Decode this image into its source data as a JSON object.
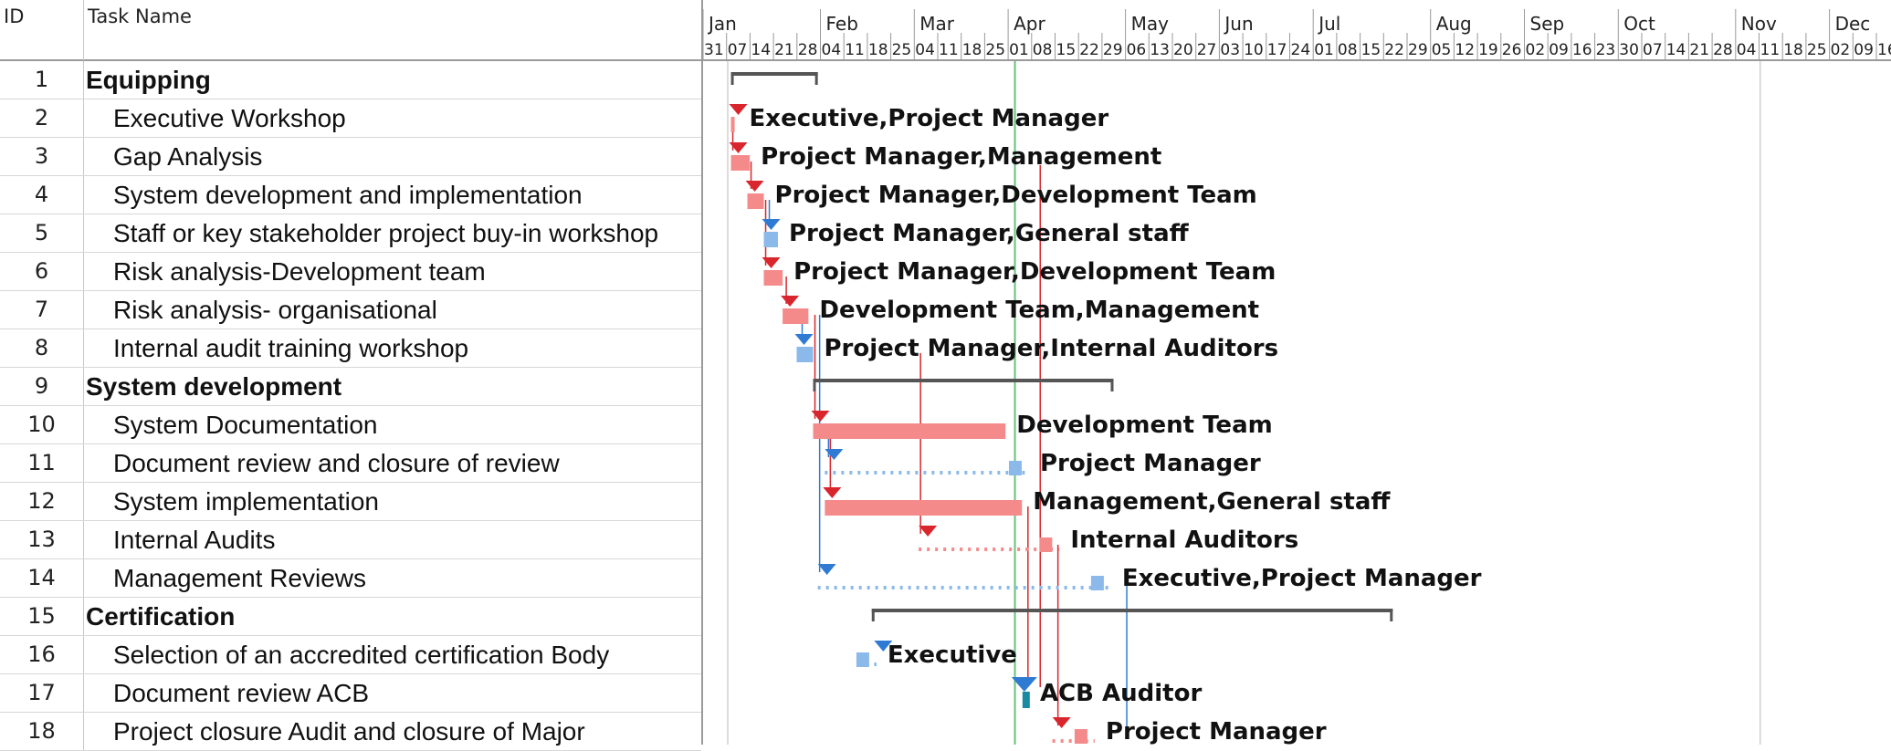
{
  "grid": {
    "col_id": "ID",
    "col_name": "Task Name",
    "rows": [
      {
        "id": "1",
        "name": "Equipping",
        "summary": true
      },
      {
        "id": "2",
        "name": "Executive Workshop",
        "summary": false
      },
      {
        "id": "3",
        "name": "Gap Analysis",
        "summary": false
      },
      {
        "id": "4",
        "name": "System development and implementation",
        "summary": false
      },
      {
        "id": "5",
        "name": "Staff or key stakeholder project buy-in workshop",
        "summary": false
      },
      {
        "id": "6",
        "name": "Risk analysis-Development team",
        "summary": false
      },
      {
        "id": "7",
        "name": "Risk analysis- organisational",
        "summary": false
      },
      {
        "id": "8",
        "name": "Internal audit training workshop",
        "summary": false
      },
      {
        "id": "9",
        "name": "System development",
        "summary": true
      },
      {
        "id": "10",
        "name": "System Documentation",
        "summary": false
      },
      {
        "id": "11",
        "name": "Document review and closure of review",
        "summary": false
      },
      {
        "id": "12",
        "name": "System implementation",
        "summary": false
      },
      {
        "id": "13",
        "name": "Internal Audits",
        "summary": false
      },
      {
        "id": "14",
        "name": "Management Reviews",
        "summary": false
      },
      {
        "id": "15",
        "name": "Certification",
        "summary": true
      },
      {
        "id": "16",
        "name": "Selection of an accredited certification Body",
        "summary": false
      },
      {
        "id": "17",
        "name": "Document review ACB",
        "summary": false
      },
      {
        "id": "18",
        "name": "Project closure Audit and closure of Major",
        "summary": false
      }
    ]
  },
  "timeline": {
    "months": [
      "Jan",
      "Feb",
      "Mar",
      "Apr",
      "May",
      "Jun",
      "Jul",
      "Aug",
      "Sep",
      "Oct",
      "Nov",
      "Dec"
    ],
    "weeks": [
      "31",
      "07",
      "14",
      "21",
      "28",
      "04",
      "11",
      "18",
      "25",
      "04",
      "11",
      "18",
      "25",
      "01",
      "08",
      "15",
      "22",
      "29",
      "06",
      "13",
      "20",
      "27",
      "03",
      "10",
      "17",
      "24",
      "01",
      "08",
      "15",
      "22",
      "29",
      "05",
      "12",
      "19",
      "26",
      "02",
      "09",
      "16",
      "23",
      "30",
      "07",
      "14",
      "21",
      "28",
      "04",
      "11",
      "18",
      "25",
      "02",
      "09",
      "16"
    ]
  },
  "gantt": {
    "today_week": 12.9,
    "colors": {
      "critical": "#f58a8a",
      "critical_dark": "#d9262c",
      "normal": "#8ab9ea",
      "normal_dark": "#2f7bd4",
      "summary": "#555555",
      "today": "#67c27a",
      "milestone": "#1a8aa0"
    },
    "bars": [
      {
        "row": 1,
        "kind": "summary",
        "start": 0.8,
        "end": 4.5
      },
      {
        "row": 2,
        "kind": "critical",
        "start": 0.8,
        "end": 0.8,
        "label": "Executive,Project Manager"
      },
      {
        "row": 3,
        "kind": "critical",
        "start": 0.8,
        "end": 1.6,
        "label": "Project Manager,Management"
      },
      {
        "row": 4,
        "kind": "critical",
        "start": 1.5,
        "end": 2.2,
        "label": "Project Manager,Development Team"
      },
      {
        "row": 5,
        "kind": "normal",
        "start": 2.2,
        "end": 2.8,
        "label": "Project Manager,General staff"
      },
      {
        "row": 6,
        "kind": "critical",
        "start": 2.2,
        "end": 3.0,
        "label": "Project Manager,Development Team"
      },
      {
        "row": 7,
        "kind": "critical",
        "start": 3.0,
        "end": 4.1,
        "label": "Development Team,Management"
      },
      {
        "row": 8,
        "kind": "normal",
        "start": 3.6,
        "end": 4.3,
        "label": "Project Manager,Internal Auditors"
      },
      {
        "row": 9,
        "kind": "summary",
        "start": 4.3,
        "end": 17.1
      },
      {
        "row": 10,
        "kind": "critical",
        "start": 4.3,
        "end": 12.5,
        "label": "Development Team"
      },
      {
        "row": 11,
        "kind": "dotted",
        "start": 4.8,
        "end": 13.5,
        "color": "normal",
        "label": "Project Manager"
      },
      {
        "row": 12,
        "kind": "critical",
        "start": 4.8,
        "end": 13.2,
        "label": "Management,General staff"
      },
      {
        "row": 13,
        "kind": "dotted",
        "start": 8.8,
        "end": 14.8,
        "color": "critical",
        "label": "Internal Auditors"
      },
      {
        "row": 14,
        "kind": "dotted",
        "start": 4.5,
        "end": 17.0,
        "color": "normal",
        "label": "Executive,Project Manager"
      },
      {
        "row": 15,
        "kind": "summary",
        "start": 6.8,
        "end": 29.0
      },
      {
        "row": 16,
        "kind": "dotted",
        "start": 6.9,
        "end": 7.0,
        "color": "normal",
        "label": "Executive"
      },
      {
        "row": 17,
        "kind": "milestone",
        "start": 13.3,
        "end": 13.5,
        "label": "ACB Auditor"
      },
      {
        "row": 18,
        "kind": "dotted",
        "start": 14.5,
        "end": 16.3,
        "color": "critical",
        "label": "Project Manager"
      }
    ]
  }
}
